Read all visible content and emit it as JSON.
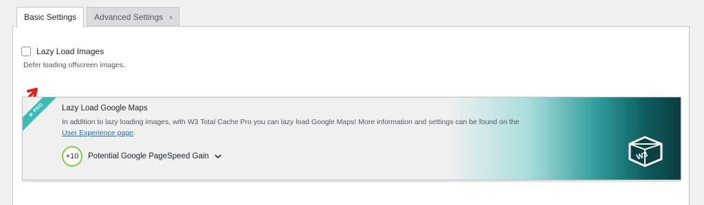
{
  "tabs": {
    "basic_label": "Basic Settings",
    "advanced_label": "Advanced Settings"
  },
  "lazy_load": {
    "label": "Lazy Load Images",
    "description": "Defer loading offscreen images.",
    "checked": false
  },
  "pro_card": {
    "ribbon": "★ PRO",
    "title": "Lazy Load Google Maps",
    "description_before_link": "In addition to lazy loading images, with W3 Total Cache Pro you can lazy load Google Maps! More information and settings can be found on the ",
    "link_text": "User Experience page",
    "description_after_link": ".",
    "gain_value": "+10",
    "gain_label": "Potential Google PageSpeed Gain",
    "logo_text": "W3"
  },
  "colors": {
    "accent_link": "#2271b1",
    "ribbon": "#3bbbb8",
    "gain_ring": "#7ad03a",
    "annotation_arrow": "#e02020"
  }
}
